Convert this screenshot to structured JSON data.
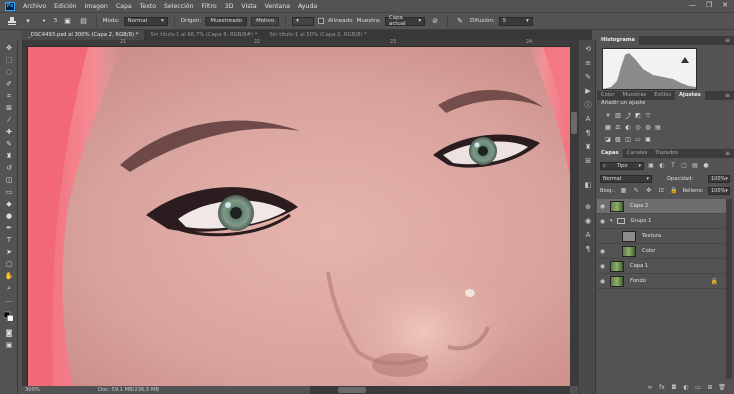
{
  "menu": {
    "logo": "Ps",
    "items": [
      "Archivo",
      "Edición",
      "Imagen",
      "Capa",
      "Texto",
      "Selección",
      "Filtro",
      "3D",
      "Vista",
      "Ventana",
      "Ayuda"
    ],
    "window_controls": [
      "—",
      "❐",
      "✕"
    ]
  },
  "options": {
    "size": "5",
    "mode_label": "Modo:",
    "mode_value": "Normal",
    "origin_label": "Origen:",
    "origin_sampled": "Muestreado",
    "origin_pattern": "Motivo",
    "aligned_label": "Alineado",
    "sample_label": "Muestra:",
    "sample_value": "Capa actual",
    "diffusion_label": "Difusión:",
    "diffusion_value": "5"
  },
  "tabs": [
    "_DSC4493.psd al 300% (Capa 2, RGB/8) *",
    "Sin título-1 al 66,7% (Capa 8, RGB/8#) *",
    "Sin título-1 al 50% (Capa 2, RGB/8) *"
  ],
  "rulers": {
    "top": [
      "21",
      "22",
      "23",
      "24"
    ]
  },
  "status": {
    "zoom": "300%",
    "doc": "Doc: 59,1 MB/236,5 MB"
  },
  "panels": {
    "top_tab": "Histograma",
    "adjust_tabs": [
      "Color",
      "Muestras",
      "Estilos",
      "Ajustes"
    ],
    "adjust_title": "Añadir un ajuste",
    "layers_tabs": [
      "Capas",
      "Canales",
      "Trazados"
    ],
    "filter_value": "Tipo",
    "blend_value": "Normal",
    "opacity_label": "Opacidad:",
    "opacity_value": "100%",
    "lock_label": "Bloq.:",
    "fill_label": "Relleno:",
    "fill_value": "100%"
  },
  "layers": [
    {
      "name": "Capa 2",
      "selected": true
    },
    {
      "name": "Grupo 1",
      "group": true
    },
    {
      "name": "Textura"
    },
    {
      "name": "Color"
    },
    {
      "name": "Capa 1"
    },
    {
      "name": "Fondo",
      "italic": true,
      "locked": true
    }
  ],
  "colors": {
    "app_bg": "#535353",
    "hair": "#f06a78",
    "skin": "#d9a6a0",
    "iris": "#6f8a7a",
    "ps_blue": "#31a8ff"
  }
}
